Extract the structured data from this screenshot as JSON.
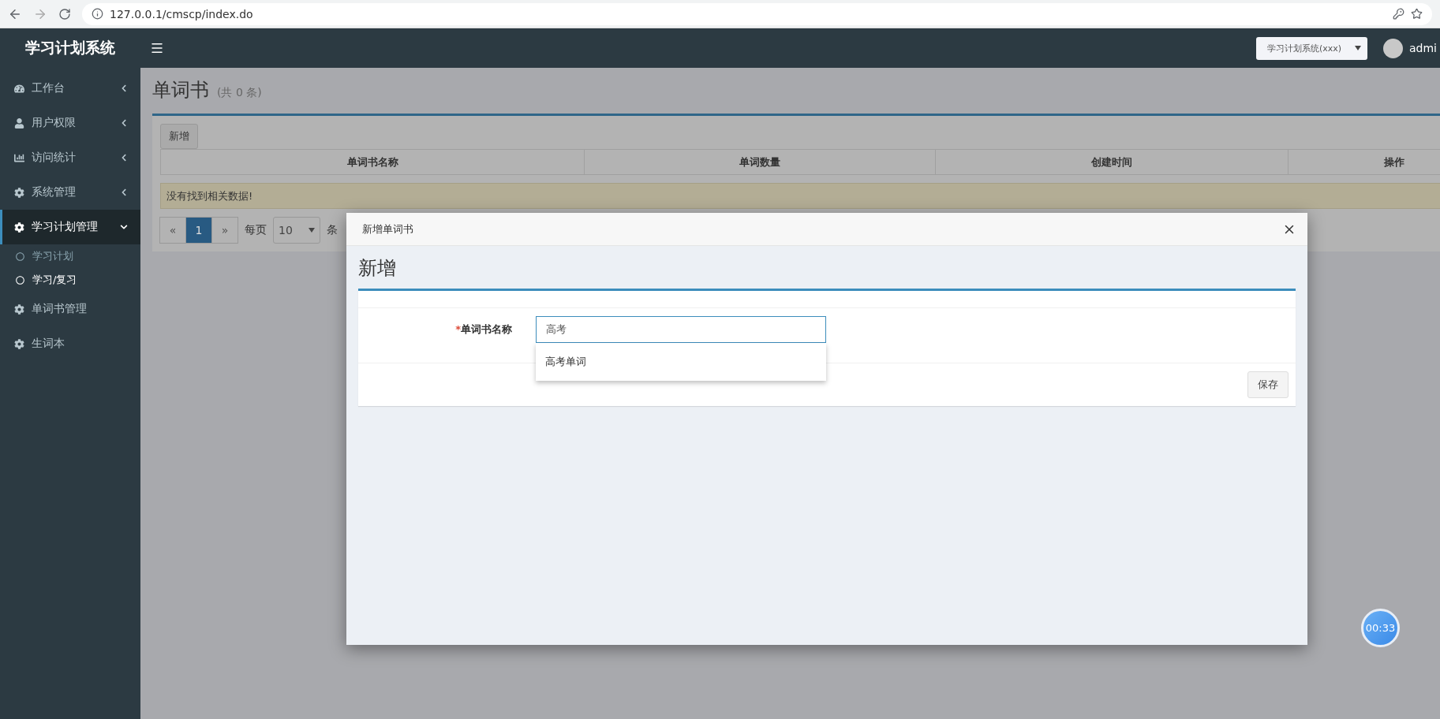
{
  "browser": {
    "url": "127.0.0.1/cmscp/index.do"
  },
  "header": {
    "logo": "学习计划系统",
    "system_select": "学习计划系统(xxx)",
    "user": "admi"
  },
  "sidebar": {
    "items": [
      {
        "label": "工作台",
        "kind": "group",
        "expanded": false,
        "selected": false
      },
      {
        "label": "用户权限",
        "kind": "group",
        "expanded": false,
        "selected": false
      },
      {
        "label": "访问统计",
        "kind": "group",
        "expanded": false,
        "selected": false
      },
      {
        "label": "系统管理",
        "kind": "group",
        "expanded": false,
        "selected": false
      },
      {
        "label": "学习计划管理",
        "kind": "group",
        "expanded": true,
        "selected": true,
        "children": [
          {
            "label": "学习计划",
            "selected": false
          },
          {
            "label": "学习/复习",
            "selected": true
          }
        ]
      },
      {
        "label": "单词书管理",
        "kind": "link",
        "selected": false
      },
      {
        "label": "生词本",
        "kind": "link",
        "selected": false
      }
    ]
  },
  "page": {
    "title": "单词书",
    "count": "(共 0 条)",
    "add_button": "新增",
    "table": {
      "columns": [
        "单词书名称",
        "单词数量",
        "创建时间",
        "操作"
      ],
      "empty_message": "没有找到相关数据!"
    },
    "pagination": {
      "prev": "«",
      "pages": [
        {
          "label": "1",
          "selected": true
        }
      ],
      "next": "»",
      "per_page_label": "每页",
      "per_page": "10",
      "unit": "条"
    }
  },
  "modal": {
    "title": "新增单词书",
    "heading": "新增",
    "field": {
      "label": "单词书名称",
      "required_mark": "*",
      "value": "高考",
      "suggestions": [
        "高考单词"
      ]
    },
    "save_button": "保存"
  },
  "timer": "00:33"
}
